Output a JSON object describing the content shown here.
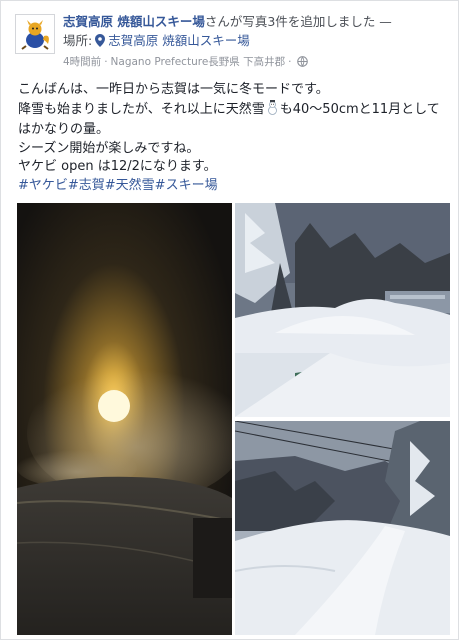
{
  "post": {
    "page_name": "志賀高原 焼額山スキー場",
    "action_text": "さんが写真3件を追加しました —",
    "location_prefix": "場所:",
    "location_name": "志賀高原 焼額山スキー場",
    "time": "4時間前",
    "place_detail": "Nagano Prefecture長野県 下高井郡",
    "audience_icon": "globe-icon",
    "text_lines": [
      "こんばんは、一昨日から志賀は一気に冬モードです。",
      "降雪も始まりましたが、それ以上に天然雪",
      "も40〜50cmと11月として",
      "はかなりの量。",
      "シーズン開始が楽しみですね。",
      "ヤケビ open は12/2になります。"
    ],
    "hashtags": "#ヤケビ#志賀#天然雪#スキー場"
  },
  "photos": {
    "count": 3,
    "items": [
      {
        "subject": "snowmaking machine at night"
      },
      {
        "subject": "snow-covered trees and buried structure"
      },
      {
        "subject": "snowy ski slope with forest"
      }
    ]
  },
  "colors": {
    "link": "#365899",
    "meta": "#90949c",
    "text": "#1d2129"
  }
}
